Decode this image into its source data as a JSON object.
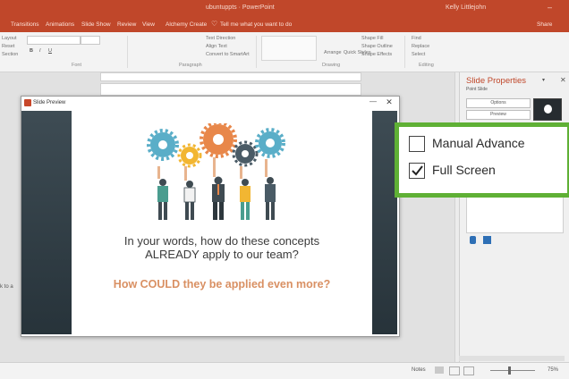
{
  "window": {
    "title": "ubuntuppts · PowerPoint",
    "user": "Kelly Littlejohn"
  },
  "tabs": [
    {
      "label": "Transitions"
    },
    {
      "label": "Animations"
    },
    {
      "label": "Slide Show"
    },
    {
      "label": "Review"
    },
    {
      "label": "View"
    },
    {
      "label": "Alchemy Create"
    },
    {
      "label": "Tell me what you want to do"
    }
  ],
  "share_label": "Share",
  "ribbon": {
    "groups": [
      {
        "label": "Font"
      },
      {
        "label": "Paragraph"
      },
      {
        "label": "Drawing"
      },
      {
        "label": "Editing"
      }
    ],
    "text_direction": "Text Direction",
    "align_text": "Align Text",
    "convert_smartart": "Convert to SmartArt",
    "arrange": "Arrange",
    "quick_styles": "Quick Styles",
    "shape_fill": "Shape Fill",
    "shape_outline": "Shape Outline",
    "shape_effects": "Shape Effects",
    "find": "Find",
    "replace": "Replace",
    "select": "Select",
    "layout_label": "Layout",
    "reset_label": "Reset",
    "section_label": "Section"
  },
  "preview_window": {
    "title": "Slide Preview",
    "question": "In your words, how do these concepts ALREADY apply to our team?",
    "question_line1": "In your words, how do these concepts",
    "question_line2": "ALREADY apply to our team?",
    "subquestion": "How COULD they be applied even more?"
  },
  "pane": {
    "title": "Slide Properties",
    "subtitle": "Point Slide",
    "options_button": "Options",
    "preview_button": "Preview"
  },
  "callout": {
    "options": [
      {
        "label": "Manual Advance",
        "checked": false
      },
      {
        "label": "Full Screen",
        "checked": true
      }
    ]
  },
  "status": {
    "notes": "Notes",
    "zoom": "75%"
  },
  "left_cut_text": "k to a",
  "colors": {
    "accent": "#c0472a",
    "callout_border": "#5fb035",
    "gear_teal": "#5aaec8",
    "gear_orange": "#e8874a",
    "gear_yellow": "#f2b632",
    "gear_slate": "#4a5b66",
    "subquestion": "#d99063"
  }
}
